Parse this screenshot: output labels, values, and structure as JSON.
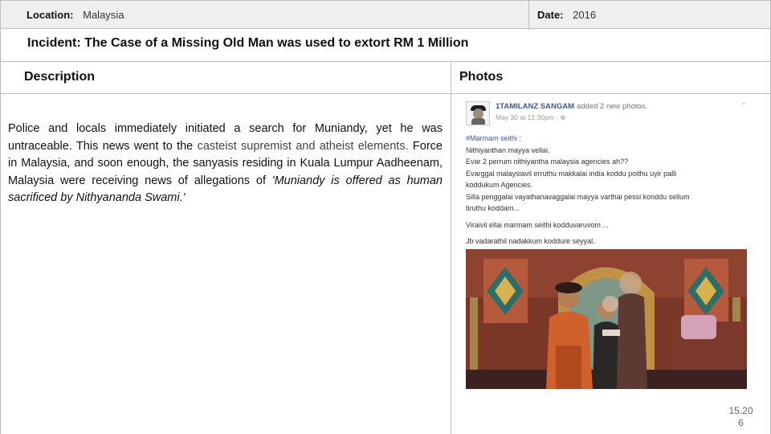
{
  "header": {
    "location_label": "Location:",
    "location_value": "Malaysia",
    "date_label": "Date:",
    "date_value": "2016"
  },
  "incident": {
    "title": "Incident: The Case of a Missing Old Man was used to extort RM 1 Million"
  },
  "columns": {
    "description": "Description",
    "photos": "Photos"
  },
  "description": {
    "p1": "Police and locals immediately initiated a search for Muniandy, yet he was untraceable. This news went to the ",
    "p2": "casteist supremist and atheist elements.",
    "p3": " Force in Malaysia, and soon enough, the sanyasis residing in Kuala Lumpur Aadheenam, Malaysia were receiving news of allegations of ",
    "quote": "'Muniandy is offered as human sacrificed by Nithyananda Swami.'"
  },
  "post": {
    "author": "1TAMILANZ SANGAM",
    "action": "added 2 new photos.",
    "time": "May 30 at 12:30pm · ⊕",
    "lines": [
      "#Marmam seithi ;",
      "Nithiyanthan mayya vellai.",
      "Evar 2 perrum nithiyantha malaysia agencies ah??",
      "Evarggal malaysiavil erruthu makkalai india koddu poithu uyir palli",
      "koddukum Agencies.",
      "Silla penggalai vayathanavaggalai mayya varthai pessi konddu sellum",
      "tiruthu koddam...",
      "Viraivil ellai marmam seithi kodduvaruvom ...",
      "Jb vadarathil nadakkum koddure seyyal."
    ]
  },
  "footer": {
    "page_line1": "15.20",
    "page_line2": "6"
  }
}
